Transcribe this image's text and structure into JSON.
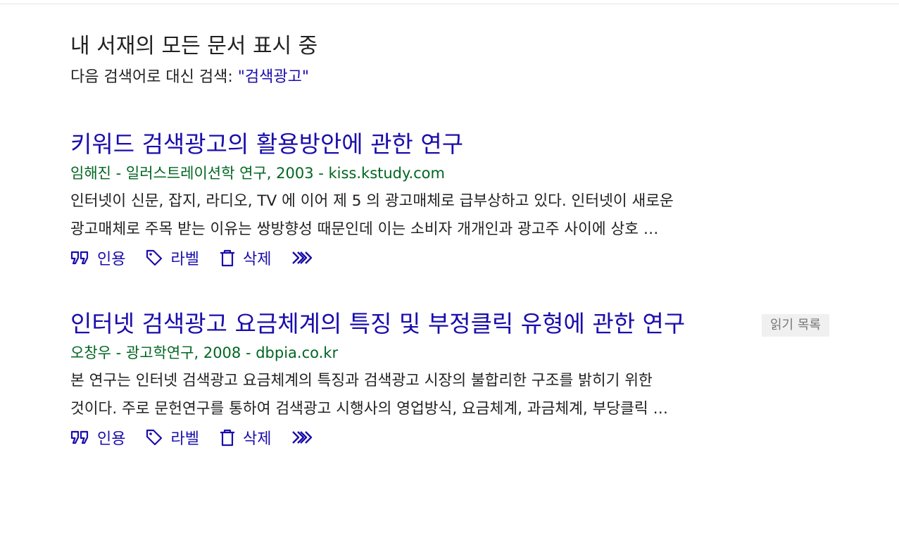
{
  "header": {
    "heading": "내 서재의 모든 문서 표시 중",
    "search_instead_prefix": "다음 검색어로 대신 검색: ",
    "search_instead_term": "\"검색광고\""
  },
  "results": [
    {
      "title": "키워드 검색광고의 활용방안에 관한 연구",
      "meta": "임해진 - 일러스트레이션학 연구, 2003 - kiss.kstudy.com",
      "snippet_line_1": "인터넷이 신문, 잡지, 라디오, TV 에 이어 제 5 의 광고매체로 급부상하고 있다. 인터넷이 새로운",
      "snippet_line_2": "광고매체로 주목 받는 이유는 쌍방향성 때문인데 이는 소비자 개개인과 광고주 사이에 상호 …",
      "badge": ""
    },
    {
      "title": "인터넷 검색광고 요금체계의 특징 및 부정클릭 유형에 관한 연구",
      "meta": "오창우 - 광고학연구, 2008 - dbpia.co.kr",
      "snippet_line_1": "본 연구는 인터넷 검색광고 요금체계의 특징과 검색광고 시장의 불합리한 구조를 밝히기 위한",
      "snippet_line_2": "것이다. 주로 문헌연구를 통하여 검색광고 시행사의 영업방식, 요금체계, 과금체계, 부당클릭 …",
      "badge": "읽기 목록"
    }
  ],
  "actions": {
    "cite_label": "인용",
    "label_label": "라벨",
    "delete_label": "삭제"
  },
  "icons": {
    "cite": "quote-icon",
    "label": "tag-icon",
    "delete": "trash-icon",
    "more": "double-chevron-right-icon"
  },
  "colors": {
    "link": "#1a0dab",
    "meta": "#006621",
    "text": "#222222",
    "badge_bg": "#f0f0f0",
    "badge_text": "#777777"
  }
}
